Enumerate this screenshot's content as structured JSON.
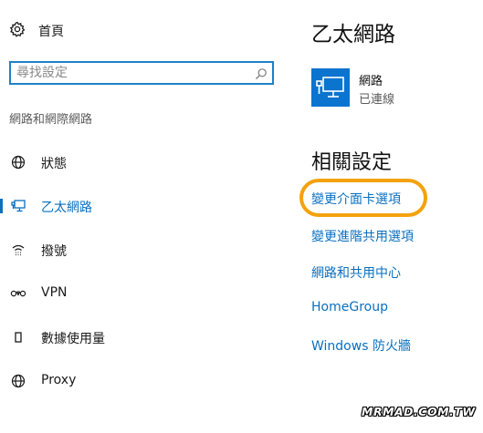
{
  "sidebar": {
    "home_label": "首頁",
    "search": {
      "placeholder": "尋找設定",
      "value": ""
    },
    "section_title": "網路和網際網路",
    "items": [
      {
        "label": "狀態",
        "icon": "globe-icon",
        "active": false
      },
      {
        "label": "乙太網路",
        "icon": "ethernet-icon",
        "active": true
      },
      {
        "label": "撥號",
        "icon": "dialup-icon",
        "active": false
      },
      {
        "label": "VPN",
        "icon": "vpn-icon",
        "active": false
      },
      {
        "label": "數據使用量",
        "icon": "data-usage-icon",
        "active": false
      },
      {
        "label": "Proxy",
        "icon": "globe-icon",
        "active": false
      }
    ]
  },
  "main": {
    "title": "乙太網路",
    "device": {
      "name": "網路",
      "status": "已連線",
      "icon": "ethernet-icon"
    },
    "related_title": "相關設定",
    "related_links": [
      "變更介面卡選項",
      "變更進階共用選項",
      "網路和共用中心",
      "HomeGroup",
      "Windows 防火牆"
    ]
  },
  "highlight": {
    "target": "變更介面卡選項",
    "color": "#f3a20c"
  },
  "colors": {
    "accent": "#0a6fbe",
    "tile": "#0a74cf",
    "search_border": "#1e82c8"
  },
  "watermark": "MRMAD.COM.TW"
}
